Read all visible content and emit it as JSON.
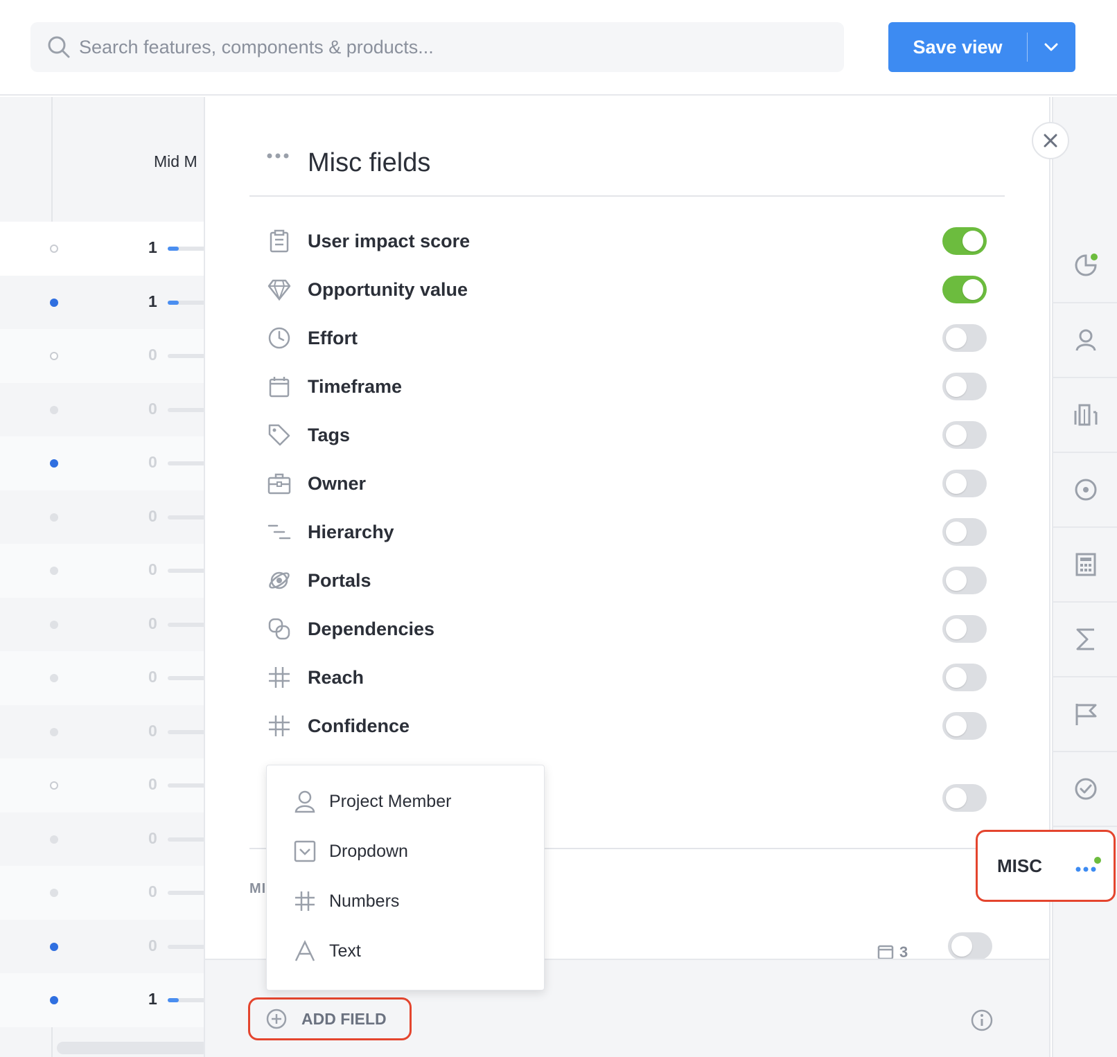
{
  "search": {
    "placeholder": "Search features, components & products..."
  },
  "save_view": {
    "label": "Save view"
  },
  "background_table": {
    "column_header": "Mid M",
    "rows": [
      {
        "value": "1",
        "dot": "hollow",
        "bar": true,
        "bold": true
      },
      {
        "value": "1",
        "dot": "blue",
        "bar": true,
        "bold": true
      },
      {
        "value": "0",
        "dot": "hollow",
        "bar": false,
        "bold": false
      },
      {
        "value": "0",
        "dot": "grey",
        "bar": false,
        "bold": false
      },
      {
        "value": "0",
        "dot": "blue",
        "bar": false,
        "bold": false
      },
      {
        "value": "0",
        "dot": "grey",
        "bar": false,
        "bold": false
      },
      {
        "value": "0",
        "dot": "grey",
        "bar": false,
        "bold": false
      },
      {
        "value": "0",
        "dot": "grey",
        "bar": false,
        "bold": false
      },
      {
        "value": "0",
        "dot": "grey",
        "bar": false,
        "bold": false
      },
      {
        "value": "0",
        "dot": "grey",
        "bar": false,
        "bold": false
      },
      {
        "value": "0",
        "dot": "hollow",
        "bar": false,
        "bold": false
      },
      {
        "value": "0",
        "dot": "grey",
        "bar": false,
        "bold": false
      },
      {
        "value": "0",
        "dot": "grey",
        "bar": false,
        "bold": false
      },
      {
        "value": "0",
        "dot": "blue",
        "bar": false,
        "bold": false
      },
      {
        "value": "1",
        "dot": "blue",
        "bar": true,
        "bold": true
      }
    ]
  },
  "panel": {
    "title": "Misc fields",
    "fields": [
      {
        "label": "User impact score",
        "icon": "clipboard-icon",
        "on": true
      },
      {
        "label": "Opportunity value",
        "icon": "diamond-icon",
        "on": true
      },
      {
        "label": "Effort",
        "icon": "clock-icon",
        "on": false
      },
      {
        "label": "Timeframe",
        "icon": "calendar-icon",
        "on": false
      },
      {
        "label": "Tags",
        "icon": "tag-icon",
        "on": false
      },
      {
        "label": "Owner",
        "icon": "briefcase-icon",
        "on": false
      },
      {
        "label": "Hierarchy",
        "icon": "hierarchy-icon",
        "on": false
      },
      {
        "label": "Portals",
        "icon": "portal-icon",
        "on": false
      },
      {
        "label": "Dependencies",
        "icon": "link-icon",
        "on": false
      },
      {
        "label": "Reach",
        "icon": "hash-icon",
        "on": false
      },
      {
        "label": "Confidence",
        "icon": "hash-icon",
        "on": false
      }
    ],
    "hidden_field_toggle_on": false,
    "section_label": "MI",
    "section_item_count": "3",
    "section_item_toggle_on": false,
    "add_field_label": "ADD FIELD"
  },
  "add_field_menu": {
    "items": [
      {
        "label": "Project Member",
        "icon": "person-icon"
      },
      {
        "label": "Dropdown",
        "icon": "dropdown-icon"
      },
      {
        "label": "Numbers",
        "icon": "hash-icon"
      },
      {
        "label": "Text",
        "icon": "text-icon"
      }
    ]
  },
  "sidebar": {
    "tabs": [
      "pie-chart-icon",
      "person-icon",
      "building-icon",
      "target-icon",
      "calculator-icon",
      "sigma-icon",
      "flag-icon",
      "check-circle-icon"
    ],
    "misc_tab_label": "MISC"
  },
  "colors": {
    "accent": "#3d8bf2",
    "toggle_on": "#6cbc3e",
    "highlight": "#e4452e"
  }
}
